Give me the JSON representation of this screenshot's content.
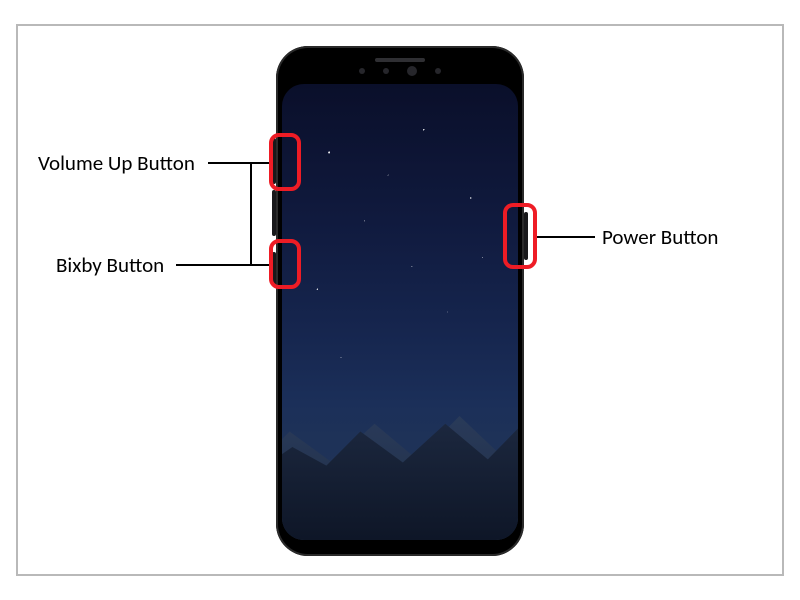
{
  "diagram": {
    "labels": {
      "volume_up": "Volume Up Button",
      "bixby": "Bixby Button",
      "power": "Power Button"
    },
    "callout_color": "#ee1c25"
  }
}
